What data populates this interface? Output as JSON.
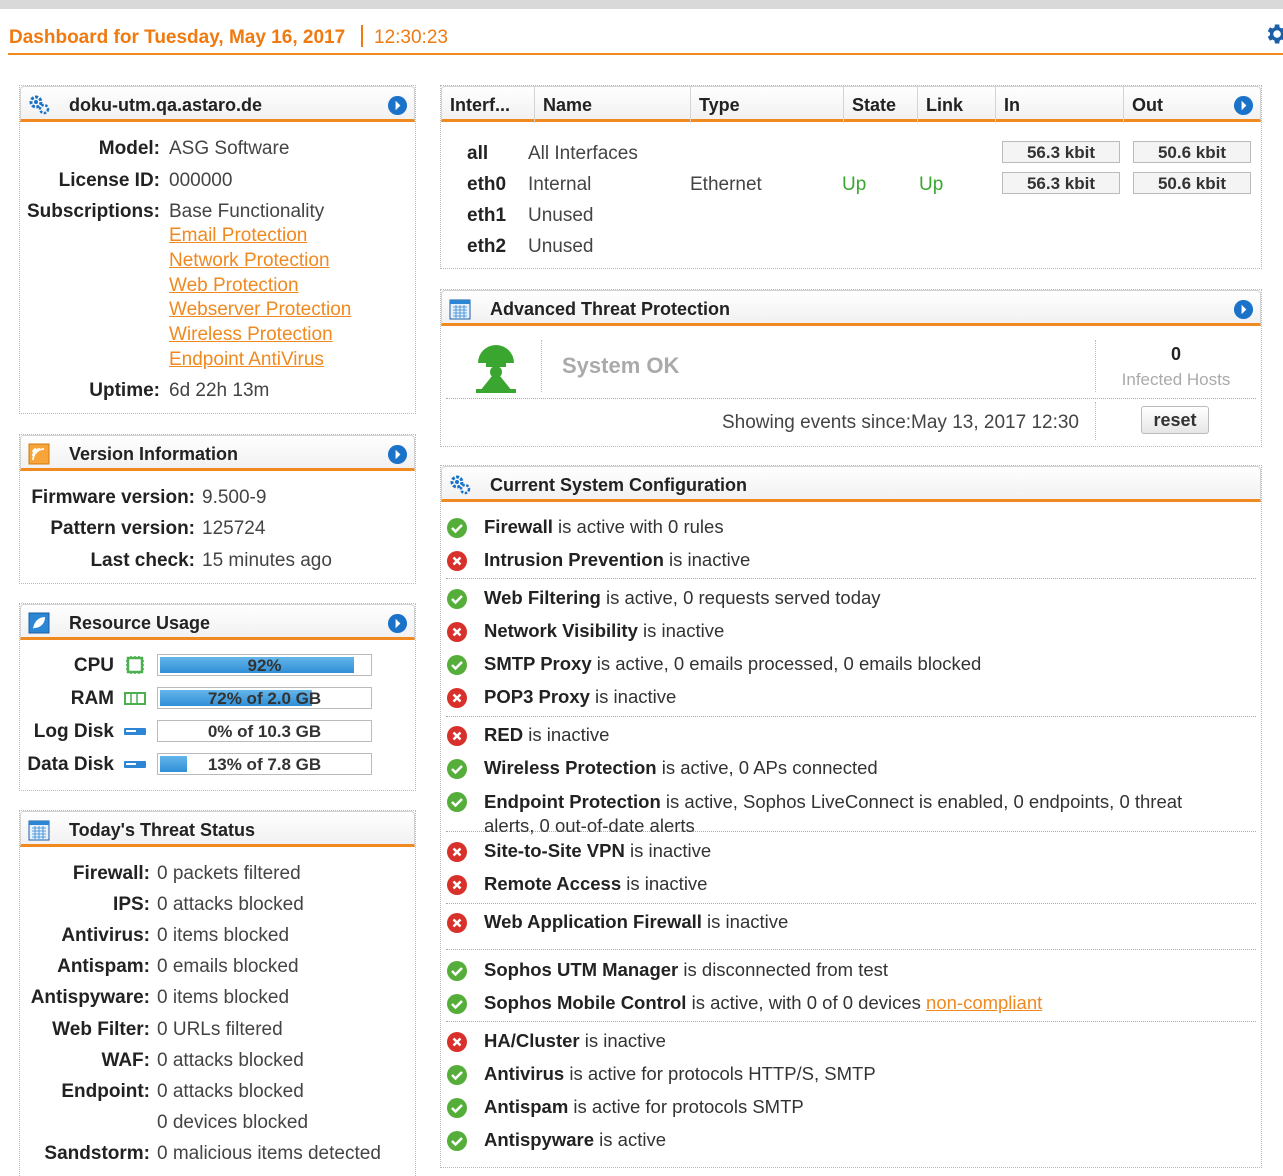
{
  "header": {
    "title": "Dashboard for Tuesday, May 16, 2017",
    "time": "12:30:23"
  },
  "colors": {
    "accent": "#f0891f",
    "ok": "#55ae3a",
    "error": "#d8302a",
    "info": "#1a73c9"
  },
  "host_panel": {
    "title": "doku-utm.qa.astaro.de",
    "model_label": "Model:",
    "model": "ASG Software",
    "license_label": "License ID:",
    "license": "000000",
    "subscriptions_label": "Subscriptions:",
    "subscriptions": [
      "Base Functionality",
      "Email Protection",
      "Network Protection",
      "Web Protection",
      "Webserver Protection",
      "Wireless Protection",
      "Endpoint AntiVirus"
    ],
    "uptime_label": "Uptime:",
    "uptime": "6d 22h 13m"
  },
  "version_panel": {
    "title": "Version Information",
    "firmware_label": "Firmware version:",
    "firmware": "9.500-9",
    "pattern_label": "Pattern version:",
    "pattern": "125724",
    "lastcheck_label": "Last check:",
    "lastcheck": "15 minutes ago"
  },
  "resource_panel": {
    "title": "Resource Usage",
    "items": [
      {
        "label": "CPU",
        "text": "92%",
        "fraction": 0.92,
        "icon": "cpu-icon"
      },
      {
        "label": "RAM",
        "text": "72% of 2.0 GB",
        "fraction": 0.72,
        "icon": "ram-icon"
      },
      {
        "label": "Log Disk",
        "text": "0% of 10.3 GB",
        "fraction": 0.0,
        "icon": "disk-icon"
      },
      {
        "label": "Data Disk",
        "text": "13% of 7.8 GB",
        "fraction": 0.13,
        "icon": "disk-icon"
      }
    ]
  },
  "threat_panel": {
    "title": "Today's Threat Status",
    "rows": [
      {
        "label": "Firewall:",
        "value": "0 packets filtered"
      },
      {
        "label": "IPS:",
        "value": "0 attacks blocked"
      },
      {
        "label": "Antivirus:",
        "value": "0 items blocked"
      },
      {
        "label": "Antispam:",
        "value": "0 emails blocked"
      },
      {
        "label": "Antispyware:",
        "value": "0 items blocked"
      },
      {
        "label": "Web Filter:",
        "value": "0 URLs filtered"
      },
      {
        "label": "WAF:",
        "value": "0 attacks blocked"
      },
      {
        "label": "Endpoint:",
        "value": "0 attacks blocked"
      },
      {
        "label": "",
        "value": "0 devices blocked"
      },
      {
        "label": "Sandstorm:",
        "value": "0 malicious items detected"
      }
    ]
  },
  "interfaces_panel": {
    "columns": [
      "Interf...",
      "Name",
      "Type",
      "State",
      "Link",
      "In",
      "Out"
    ],
    "rows": [
      {
        "iface": "all",
        "name": "All Interfaces",
        "type": "",
        "state": "",
        "link": "",
        "in": "56.3 kbit",
        "out": "50.6 kbit"
      },
      {
        "iface": "eth0",
        "name": "Internal",
        "type": "Ethernet",
        "state": "Up",
        "link": "Up",
        "in": "56.3 kbit",
        "out": "50.6 kbit"
      },
      {
        "iface": "eth1",
        "name": "Unused",
        "type": "",
        "state": "",
        "link": "",
        "in": "",
        "out": ""
      },
      {
        "iface": "eth2",
        "name": "Unused",
        "type": "",
        "state": "",
        "link": "",
        "in": "",
        "out": ""
      }
    ]
  },
  "atp_panel": {
    "title": "Advanced Threat Protection",
    "status": "System OK",
    "infected_count": "0",
    "infected_label": "Infected Hosts",
    "events_since": "Showing events since:May 13, 2017 12:30",
    "reset_label": "reset"
  },
  "config_panel": {
    "title": "Current System Configuration",
    "rows": [
      {
        "status": "ok",
        "name": "Firewall",
        "text": " is active with 0 rules"
      },
      {
        "status": "err",
        "name": "Intrusion Prevention",
        "text": " is inactive"
      },
      {
        "status": "ok",
        "name": "Web Filtering",
        "text": " is active, 0 requests served today"
      },
      {
        "status": "err",
        "name": "Network Visibility",
        "text": " is inactive"
      },
      {
        "status": "ok",
        "name": "SMTP Proxy",
        "text": " is active, 0 emails processed, 0 emails blocked"
      },
      {
        "status": "err",
        "name": "POP3 Proxy",
        "text": " is inactive"
      },
      {
        "status": "err",
        "name": "RED",
        "text": " is inactive"
      },
      {
        "status": "ok",
        "name": "Wireless Protection",
        "text": " is active, 0 APs connected"
      },
      {
        "status": "ok",
        "name": "Endpoint Protection",
        "text": " is active, Sophos LiveConnect is enabled, 0 endpoints, 0 threat",
        "text2": "alerts, 0 out-of-date alerts"
      },
      {
        "status": "err",
        "name": "Site-to-Site VPN",
        "text": " is inactive"
      },
      {
        "status": "err",
        "name": "Remote Access",
        "text": " is inactive"
      },
      {
        "status": "err",
        "name": "Web Application Firewall",
        "text": " is inactive"
      },
      {
        "status": "ok",
        "name": "Sophos UTM Manager",
        "text": " is disconnected from test"
      },
      {
        "status": "ok",
        "name": "Sophos Mobile Control",
        "text": " is active, with 0 of 0 devices ",
        "link": "non-compliant"
      },
      {
        "status": "err",
        "name": "HA/Cluster",
        "text": " is inactive"
      },
      {
        "status": "ok",
        "name": "Antivirus",
        "text": " is active for protocols HTTP/S, SMTP"
      },
      {
        "status": "ok",
        "name": "Antispam",
        "text": " is active for protocols SMTP"
      },
      {
        "status": "ok",
        "name": "Antispyware",
        "text": " is active"
      }
    ]
  }
}
